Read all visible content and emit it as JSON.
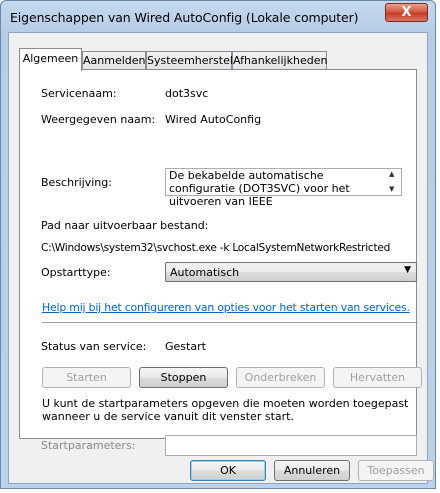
{
  "window": {
    "title": "Eigenschappen van Wired AutoConfig (Lokale computer)",
    "close_glyph": "X"
  },
  "tabs": [
    {
      "label": "Algemeen",
      "active": true
    },
    {
      "label": "Aanmelden",
      "active": false
    },
    {
      "label": "Systeemherstel",
      "active": false
    },
    {
      "label": "Afhankelijkheden",
      "active": false
    }
  ],
  "general": {
    "service_name_label": "Servicenaam:",
    "service_name_value": "dot3svc",
    "display_name_label": "Weergegeven naam:",
    "display_name_value": "Wired AutoConfig",
    "description_label": "Beschrijving:",
    "description_value": "De bekabelde automatische configuratie (DOT3SVC) voor het uitvoeren van IEEE",
    "exe_path_label": "Pad naar uitvoerbaar bestand:",
    "exe_path_value": "C:\\Windows\\system32\\svchost.exe -k LocalSystemNetworkRestricted",
    "startup_type_label": "Opstarttype:",
    "startup_type_value": "Automatisch",
    "help_link": "Help mij bij het configureren van opties voor het starten van services.",
    "status_label": "Status van service:",
    "status_value": "Gestart",
    "start_button": "Starten",
    "stop_button": "Stoppen",
    "pause_button": "Onderbreken",
    "resume_button": "Hervatten",
    "start_params_info": "U kunt de startparameters opgeven die moeten worden toegepast wanneer u de service vanuit dit venster start.",
    "start_params_label": "Startparameters:",
    "start_params_value": ""
  },
  "footer": {
    "ok_button": "OK",
    "cancel_button": "Annuleren",
    "apply_button": "Toepassen"
  },
  "icons": {
    "scroll_up": "up-arrow-icon",
    "scroll_down": "down-arrow-icon",
    "dropdown": "chevron-down-icon"
  }
}
